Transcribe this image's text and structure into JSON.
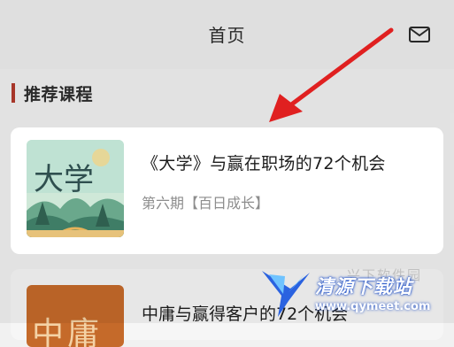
{
  "header": {
    "title": "首页",
    "mail_icon": "mail-icon"
  },
  "section": {
    "title": "推荐课程",
    "accent_color": "#b23a2c"
  },
  "courses": [
    {
      "cover_text": "大学",
      "title": "《大学》与赢在职场的72个机会",
      "subtitle": "第六期【百日成长】"
    },
    {
      "cover_text": "中庸",
      "title": "中庸与赢得客户的72个机会"
    }
  ],
  "annotation": {
    "arrow_color": "#e02020"
  },
  "watermark": {
    "name": "清源下载站",
    "url": "www.qymeet.com",
    "faint_text": "兴下软件园"
  }
}
